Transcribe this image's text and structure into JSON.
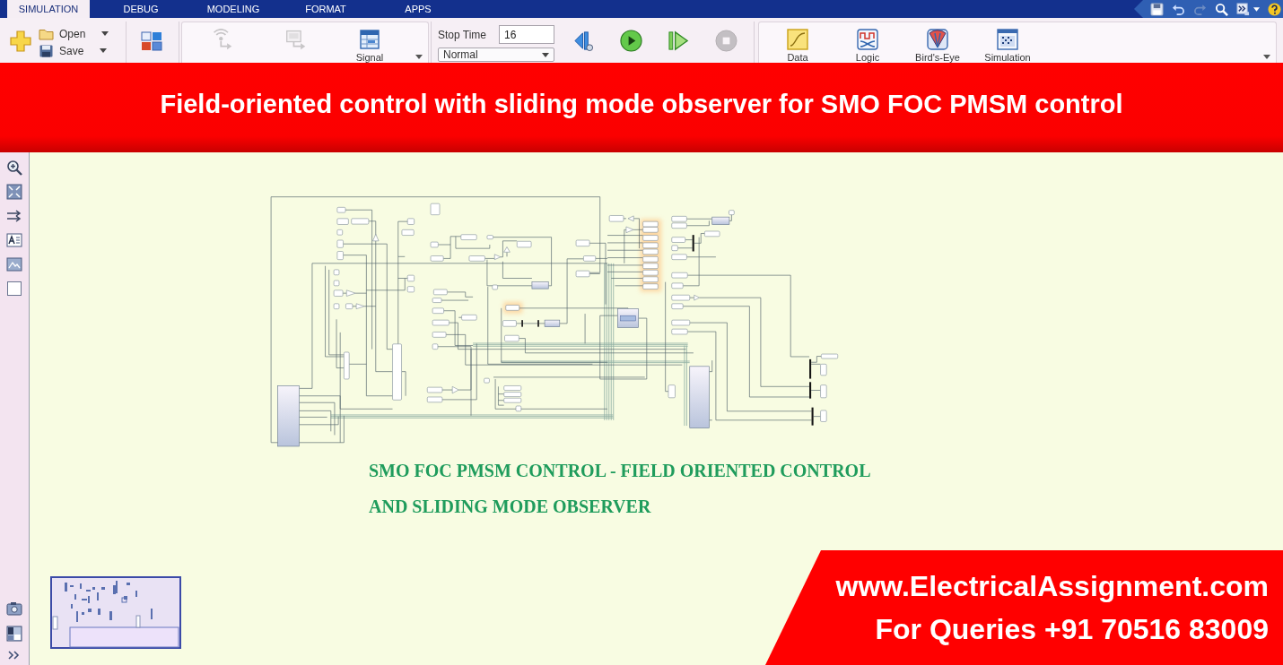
{
  "ribbon": {
    "tabs": [
      {
        "label": "SIMULATION",
        "selected": true
      },
      {
        "label": "DEBUG",
        "selected": false
      },
      {
        "label": "MODELING",
        "selected": false
      },
      {
        "label": "FORMAT",
        "selected": false
      },
      {
        "label": "APPS",
        "selected": false
      }
    ],
    "quick_access": [
      {
        "kind": "save",
        "disabled": false
      },
      {
        "kind": "undo",
        "disabled": false
      },
      {
        "kind": "redo",
        "disabled": true
      },
      {
        "kind": "search",
        "disabled": false
      },
      {
        "kind": "more",
        "disabled": false
      },
      {
        "kind": "help",
        "disabled": false
      }
    ]
  },
  "toolstrip": {
    "file": {
      "open": "Open",
      "save": "Save"
    },
    "prepare": [
      {
        "kind": "log-signals",
        "disabled": true
      },
      {
        "kind": "add-viewer",
        "disabled": true
      },
      {
        "kind": "signal-table",
        "label": "Signal",
        "disabled": false
      }
    ],
    "simulate": {
      "stop_time_label": "Stop Time",
      "stop_time": "16",
      "mode": "Normal",
      "controls": [
        {
          "kind": "step-back",
          "disabled": false
        },
        {
          "kind": "run",
          "disabled": false
        },
        {
          "kind": "step-forward",
          "disabled": false
        },
        {
          "kind": "stop",
          "disabled": true
        }
      ]
    },
    "review": [
      {
        "kind": "data",
        "label": "Data"
      },
      {
        "kind": "logic",
        "label": "Logic"
      },
      {
        "kind": "birds-eye",
        "label": "Bird's-Eye"
      },
      {
        "kind": "simulation",
        "label": "Simulation"
      }
    ]
  },
  "banner": {
    "title": "Field-oriented control with sliding mode observer for SMO FOC PMSM control"
  },
  "canvas": {
    "annotation": {
      "lines": [
        "SMO FOC PMSM CONTROL - FIELD ORIENTED CONTROL",
        "AND SLIDING MODE OBSERVER"
      ]
    }
  },
  "promo": {
    "website": "www.ElectricalAssignment.com",
    "queries": "For Queries +91 70516 83009"
  }
}
